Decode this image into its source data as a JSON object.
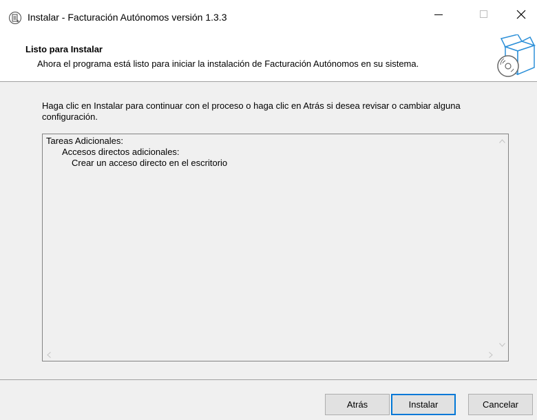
{
  "window": {
    "title": "Instalar - Facturación Autónomos versión 1.3.3",
    "icon": "installer-app-icon",
    "controls": {
      "minimize": "—",
      "maximize": "☐",
      "close": "✕"
    }
  },
  "header": {
    "title": "Listo para Instalar",
    "subtitle": "Ahora el programa está listo para iniciar la instalación de Facturación Autónomos en su sistema.",
    "art_icon": "install-box-disc-icon"
  },
  "main": {
    "instruction": "Haga clic en Instalar para continuar con el proceso o haga clic en Atrás si desea revisar o cambiar alguna configuración.",
    "memo": {
      "lines": [
        "Tareas Adicionales:",
        "Accesos directos adicionales:",
        "Crear un acceso directo en el escritorio"
      ]
    }
  },
  "buttons": {
    "back": "Atrás",
    "install": "Instalar",
    "cancel": "Cancelar"
  },
  "colors": {
    "default_button_border": "#0078d7",
    "dialog_background": "#f0f0f0",
    "button_face": "#e1e1e1"
  }
}
